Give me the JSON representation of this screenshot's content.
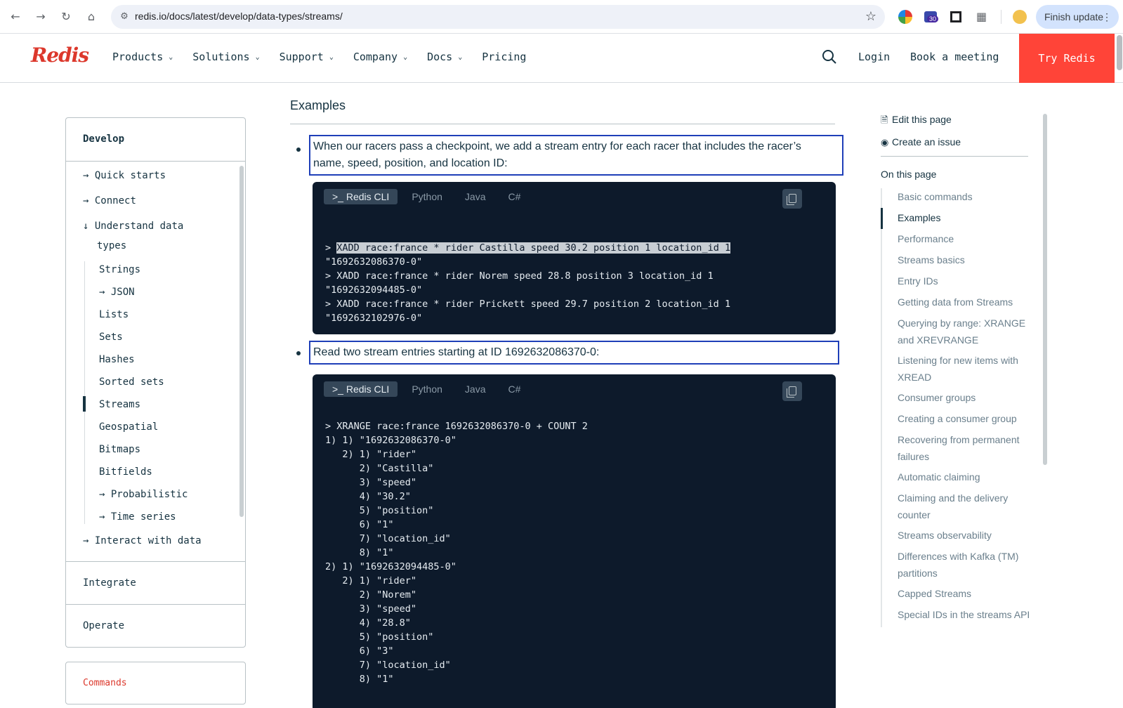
{
  "browser": {
    "url": "redis.io/docs/latest/develop/data-types/streams/",
    "finish_update": "Finish update",
    "ext_badge": "30"
  },
  "header": {
    "logo": "Redis",
    "nav": [
      "Products",
      "Solutions",
      "Support",
      "Company",
      "Docs",
      "Pricing"
    ],
    "login": "Login",
    "book": "Book a meeting",
    "try": "Try Redis"
  },
  "sidebar": {
    "title": "Develop",
    "items": [
      {
        "arrow": "→",
        "label": "Quick starts"
      },
      {
        "arrow": "→",
        "label": "Connect"
      },
      {
        "arrow": "↓",
        "label": "Understand data"
      },
      {
        "arrow": "",
        "label": "types"
      },
      {
        "arrow": "",
        "label": "Strings"
      },
      {
        "arrow": "→",
        "label": "JSON"
      },
      {
        "arrow": "",
        "label": "Lists"
      },
      {
        "arrow": "",
        "label": "Sets"
      },
      {
        "arrow": "",
        "label": "Hashes"
      },
      {
        "arrow": "",
        "label": "Sorted sets"
      },
      {
        "arrow": "",
        "label": "Streams"
      },
      {
        "arrow": "",
        "label": "Geospatial"
      },
      {
        "arrow": "",
        "label": "Bitmaps"
      },
      {
        "arrow": "",
        "label": "Bitfields"
      },
      {
        "arrow": "→",
        "label": "Probabilistic"
      },
      {
        "arrow": "→",
        "label": "Time series"
      },
      {
        "arrow": "→",
        "label": "Interact with data"
      }
    ],
    "integrate": "Integrate",
    "operate": "Operate",
    "commands": "Commands"
  },
  "content": {
    "heading": "Examples",
    "para1_line1": "When our racers pass a checkpoint, we add a stream entry for each racer that includes the racer’s",
    "para1_line2": "name, speed, position, and location ID:",
    "para2": "Read two stream entries starting at ID 1692632086370-0:",
    "tabs": ">_ Redis CLI|Python|Java|C#",
    "tab_labels": [
      ">_ Redis CLI",
      "Python",
      "Java",
      "C#"
    ],
    "code1": [
      "> XADD race:france * rider Castilla speed 30.2 position 1 location_id 1",
      "\"1692632086370-0\"",
      "> XADD race:france * rider Norem speed 28.8 position 3 location_id 1",
      "\"1692632094485-0\"",
      "> XADD race:france * rider Prickett speed 29.7 position 2 location_id 1",
      "\"1692632102976-0\""
    ],
    "code2": [
      "> XRANGE race:france 1692632086370-0 + COUNT 2",
      "1) 1) \"1692632086370-0\"",
      "   2) 1) \"rider\"",
      "      2) \"Castilla\"",
      "      3) \"speed\"",
      "      4) \"30.2\"",
      "      5) \"position\"",
      "      6) \"1\"",
      "      7) \"location_id\"",
      "      8) \"1\"",
      "2) 1) \"1692632094485-0\"",
      "   2) 1) \"rider\"",
      "      2) \"Norem\"",
      "      3) \"speed\"",
      "      4) \"28.8\"",
      "      5) \"position\"",
      "      6) \"3\"",
      "      7) \"location_id\"",
      "      8) \"1\""
    ]
  },
  "toc": {
    "edit": "Edit this page",
    "issue": "Create an issue",
    "heading": "On this page",
    "items": [
      "Basic commands",
      "Examples",
      "Performance",
      "Streams basics",
      "Entry IDs",
      "Getting data from Streams",
      "Querying by range: XRANGE and XREVRANGE",
      "Listening for new items with XREAD",
      "Consumer groups",
      "Creating a consumer group",
      "Recovering from permanent failures",
      "Automatic claiming",
      "Claiming and the delivery counter",
      "Streams observability",
      "Differences with Kafka (TM) partitions",
      "Capped Streams",
      "Special IDs in the streams API"
    ]
  }
}
